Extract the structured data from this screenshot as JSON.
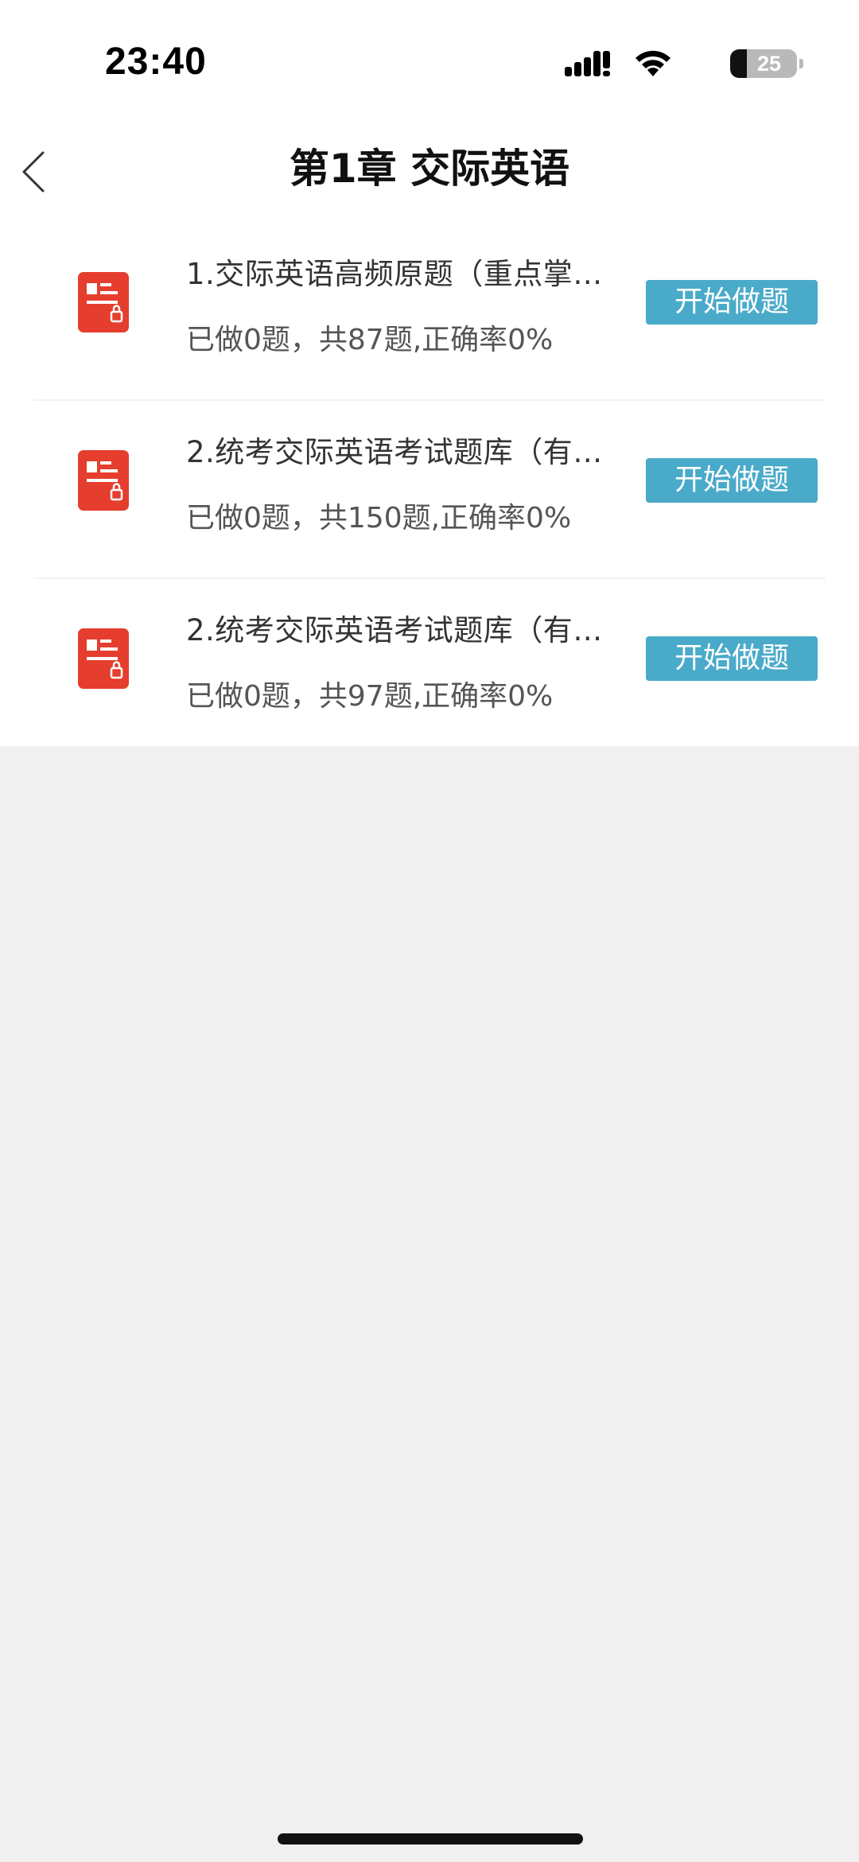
{
  "status_bar": {
    "time": "23:40",
    "battery_level": "25",
    "battery_fraction": 0.25,
    "icons": [
      "signal-icon",
      "wifi-icon",
      "battery-icon"
    ]
  },
  "nav": {
    "title": "第1章 交际英语",
    "back_icon": "chevron-left-icon"
  },
  "items": [
    {
      "title": "1.交际英语高频原题（重点掌…",
      "stats": "已做0题，共87题,正确率0%",
      "button_label": "开始做题",
      "icon": "locked-document-icon"
    },
    {
      "title": "2.统考交际英语考试题库（有…",
      "stats": "已做0题，共150题,正确率0%",
      "button_label": "开始做题",
      "icon": "locked-document-icon"
    },
    {
      "title": "2.统考交际英语考试题库（有…",
      "stats": "已做0题，共97题,正确率0%",
      "button_label": "开始做题",
      "icon": "locked-document-icon"
    }
  ],
  "colors": {
    "accent": "#4aaac9",
    "doc_icon": "#e53e2e",
    "background": "#f0f0f0"
  }
}
